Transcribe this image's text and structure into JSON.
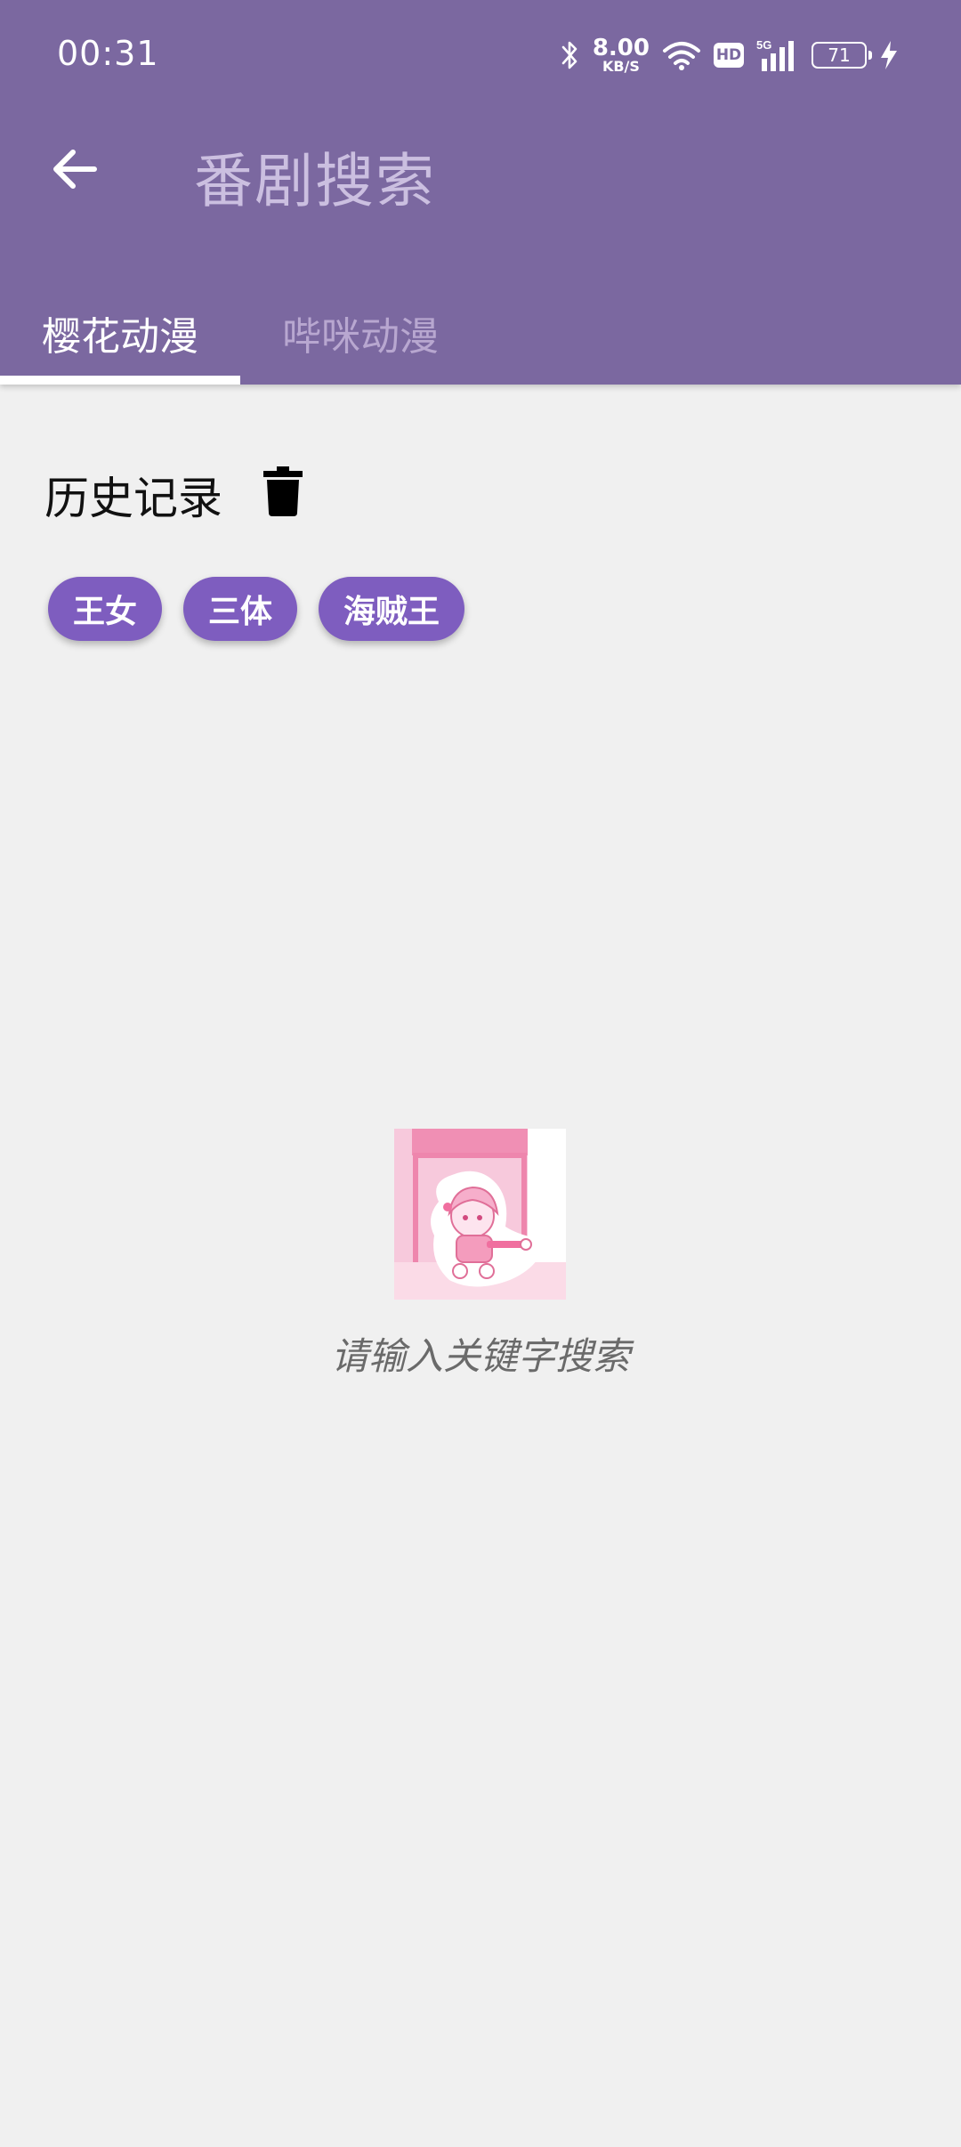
{
  "status_bar": {
    "time": "00:31",
    "net_speed_value": "8.00",
    "net_speed_unit": "KB/S",
    "hd_label": "HD",
    "network_type": "5G",
    "battery_level": "71",
    "icons": [
      "bluetooth-icon",
      "wifi-icon",
      "hd-icon",
      "signal-icon",
      "battery-icon",
      "charging-icon"
    ]
  },
  "toolbar": {
    "title": "番剧搜索",
    "back_icon": "arrow-left-icon"
  },
  "tabs": [
    {
      "label": "樱花动漫",
      "active": true
    },
    {
      "label": "哔咪动漫",
      "active": false
    }
  ],
  "history": {
    "label": "历史记录",
    "clear_icon": "trash-icon",
    "chips": [
      "王女",
      "三体",
      "海贼王"
    ]
  },
  "empty_state": {
    "image": "anime-girl-placeholder-image",
    "message": "请输入关键字搜索"
  },
  "colors": {
    "app_bar": "#7b68a0",
    "chip": "#7e5dbf",
    "background": "#f0f0f0",
    "title_text": "#cbbfe0",
    "inactive_tab": "#b8a7d0"
  }
}
